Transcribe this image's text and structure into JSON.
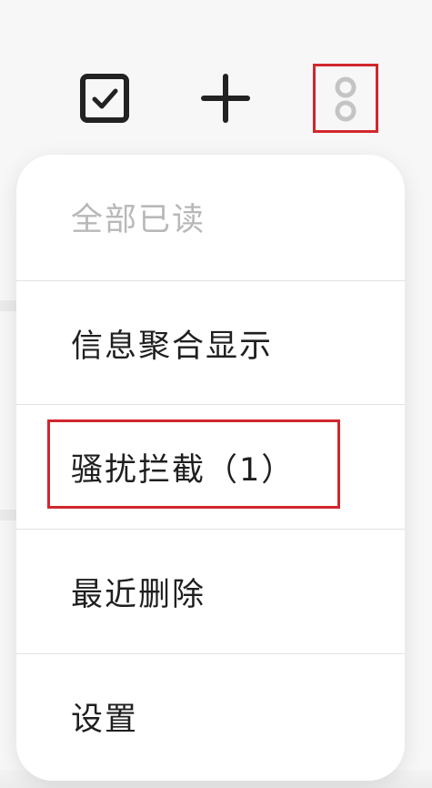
{
  "toolbar": {
    "select_icon": "checkbox-icon",
    "add_icon": "plus-icon",
    "more_icon": "more-vertical-icon"
  },
  "menu": {
    "items": [
      {
        "label": "全部已读",
        "enabled": false
      },
      {
        "label": "信息聚合显示",
        "enabled": true
      },
      {
        "label": "骚扰拦截（1）",
        "enabled": true
      },
      {
        "label": "最近删除",
        "enabled": true
      },
      {
        "label": "设置",
        "enabled": true
      }
    ]
  },
  "colors": {
    "highlight": "#d1272d",
    "icon": "#222222",
    "disabled_text": "#b8b8b8",
    "menu_background": "#ffffff"
  }
}
